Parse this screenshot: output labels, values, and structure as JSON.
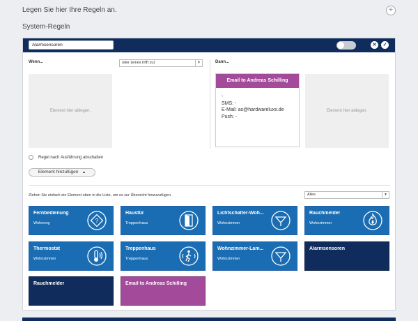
{
  "page": {
    "intro": "Legen Sie hier Ihre Regeln an.",
    "section_title": "System-Regeln"
  },
  "rule": {
    "name": "Alarmsensoren",
    "when_label": "Wenn...",
    "then_label": "Dann...",
    "condition_select": "oder (eines trifft zu)",
    "drop_placeholder": "Element hier ablegen.",
    "drop_placeholder_right": "Element hier ablegen.",
    "email_card": {
      "title": "Email to Andreas Schilling",
      "line1": "-",
      "line2": "SMS: -",
      "line3": "E-Mail: as@hardwareluxx.de",
      "line4": "Push: -"
    },
    "disable_after_run": "Regel nach Ausführung abschalten",
    "add_element": "Element hinzufügen",
    "add_element_arrow": "▲",
    "hint": "Ziehen Sie einfach ein Element oben in die Liste, um es zur Übersicht hinzuzufügen.",
    "filter_select": "Alles"
  },
  "tiles": [
    {
      "title": "Fernbedienung",
      "subtitle": "Wohnung",
      "icon": "remote-icon",
      "style": "blue"
    },
    {
      "title": "Haustür",
      "subtitle": "Treppenhaus",
      "icon": "door-icon",
      "style": "blue"
    },
    {
      "title": "Lichtschalter-Woh...",
      "subtitle": "Wohnzimmer",
      "icon": "lamp-icon",
      "style": "blue"
    },
    {
      "title": "Rauchmelder",
      "subtitle": "Wohnzimmer",
      "icon": "flame-icon",
      "style": "blue"
    },
    {
      "title": "Thermostat",
      "subtitle": "Wohnzimmer",
      "icon": "thermometer-icon",
      "style": "blue"
    },
    {
      "title": "Treppenhaus",
      "subtitle": "Treppenhaus",
      "icon": "motion-icon",
      "style": "blue"
    },
    {
      "title": "Wohnzimmer-Lam...",
      "subtitle": "Wohnzimmer",
      "icon": "lamp-icon",
      "style": "blue"
    },
    {
      "title": "Alarmsensoren",
      "subtitle": "",
      "icon": "",
      "style": "navy"
    },
    {
      "title": "Rauchmelder",
      "subtitle": "",
      "icon": "",
      "style": "navy"
    },
    {
      "title": "Email to Andreas Schilling",
      "subtitle": "",
      "icon": "",
      "style": "purple"
    }
  ],
  "colors": {
    "header_navy": "#0f2c5c",
    "tile_blue": "#1a6db3",
    "email_purple": "#a34a9a"
  }
}
